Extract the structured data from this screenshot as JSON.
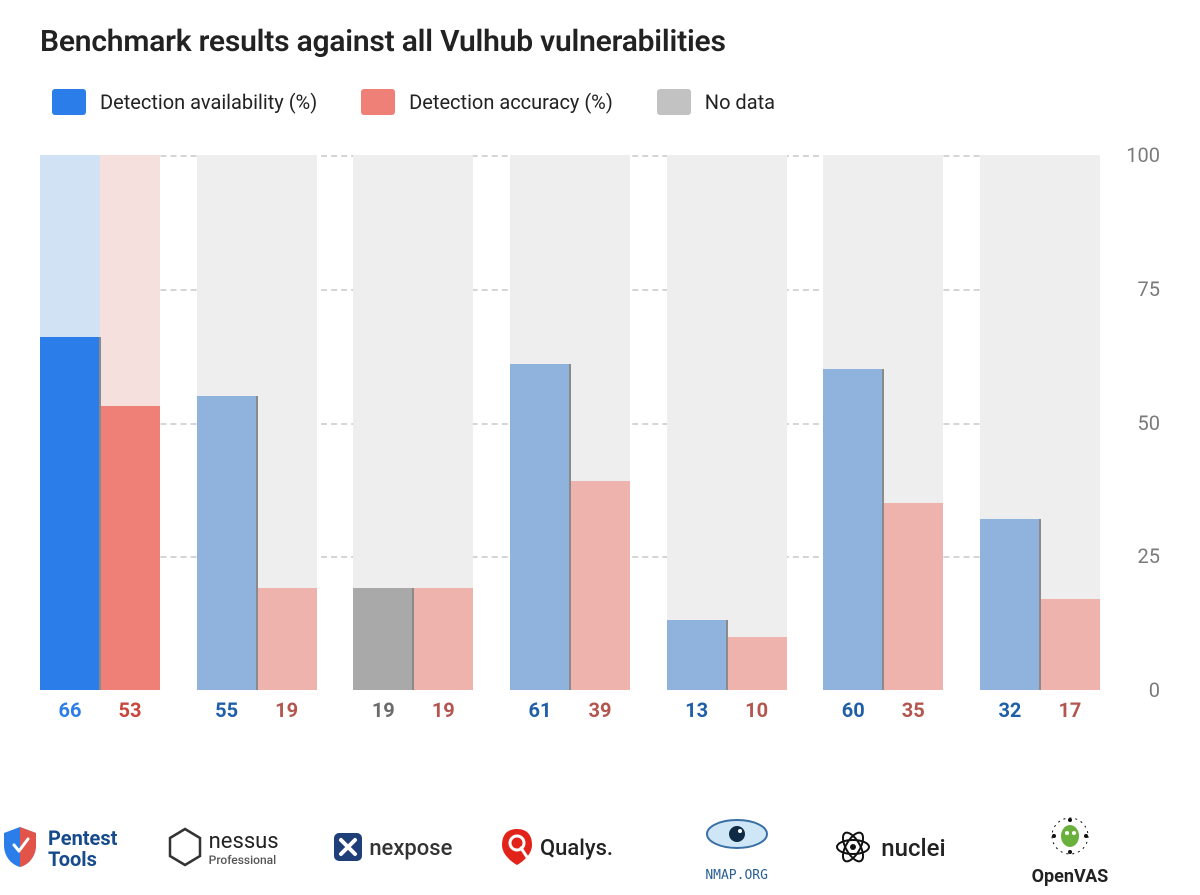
{
  "title": "Benchmark results against all Vulhub vulnerabilities",
  "legend": {
    "availability": "Detection availability (%)",
    "accuracy": "Detection accuracy (%)",
    "nodata": "No data"
  },
  "colors": {
    "avail_strong": "#2b7de9",
    "avail_muted": "#8fb3dd",
    "avail_bg": "#d2e2f5",
    "acc_strong": "#ef8077",
    "acc_muted": "#eeb3ad",
    "acc_bg": "#f5e0dd",
    "nodata_fill": "#a9a9a9",
    "nodata_swatch": "#c2c2c2",
    "grey_bg": "#eeeeee"
  },
  "yaxis": {
    "ticks": [
      0,
      25,
      50,
      75,
      100
    ]
  },
  "tools": [
    {
      "name": "Pentest Tools",
      "availability": 66,
      "accuracy": 53,
      "highlight": true,
      "noData": false
    },
    {
      "name": "Nessus",
      "sub": "Professional",
      "availability": 55,
      "accuracy": 19,
      "highlight": false,
      "noData": false
    },
    {
      "name": "Nexpose",
      "availability": 19,
      "accuracy": 19,
      "highlight": false,
      "noData": true
    },
    {
      "name": "Qualys",
      "availability": 61,
      "accuracy": 39,
      "highlight": false,
      "noData": false
    },
    {
      "name": "Nmap",
      "sub": "NMAP.ORG",
      "availability": 13,
      "accuracy": 10,
      "highlight": false,
      "noData": false
    },
    {
      "name": "nuclei",
      "availability": 60,
      "accuracy": 35,
      "highlight": false,
      "noData": false
    },
    {
      "name": "OpenVAS",
      "availability": 32,
      "accuracy": 17,
      "highlight": false,
      "noData": false
    }
  ],
  "chart_data": {
    "type": "bar",
    "title": "Benchmark results against all Vulhub vulnerabilities",
    "xlabel": "",
    "ylabel": "",
    "ylim": [
      0,
      100
    ],
    "categories": [
      "Pentest Tools",
      "Nessus Professional",
      "Nexpose",
      "Qualys",
      "Nmap",
      "nuclei",
      "OpenVAS"
    ],
    "series": [
      {
        "name": "Detection availability (%)",
        "values": [
          66,
          55,
          19,
          61,
          13,
          60,
          32
        ]
      },
      {
        "name": "Detection accuracy (%)",
        "values": [
          53,
          19,
          19,
          39,
          10,
          35,
          17
        ]
      }
    ],
    "notes": "Nexpose availability bar shown as 'No data' (grey) with value label 19.",
    "legend_position": "top-left",
    "grid": true
  }
}
